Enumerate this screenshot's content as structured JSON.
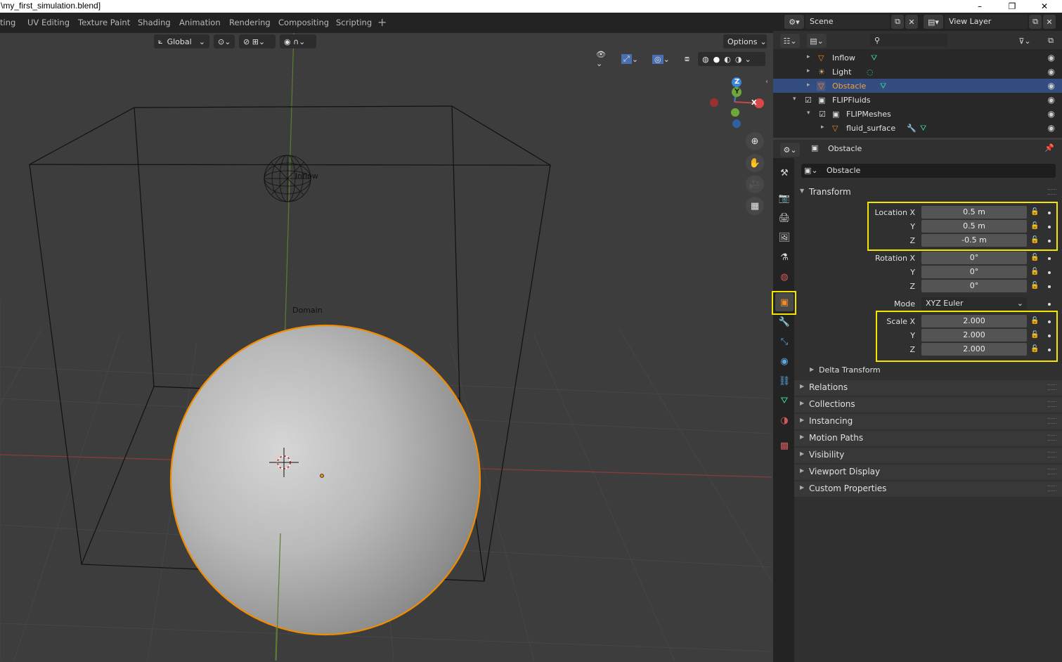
{
  "window": {
    "title": "\\my_first_simulation.blend]",
    "minimize": "–",
    "maximize": "❐",
    "close": "✕"
  },
  "workspaces": [
    "ting",
    "UV Editing",
    "Texture Paint",
    "Shading",
    "Animation",
    "Rendering",
    "Compositing",
    "Scripting"
  ],
  "add_workspace": "+",
  "scene": {
    "name": "Scene",
    "view_layer": "View Layer"
  },
  "viewport": {
    "orientation": "Global",
    "options_label": "Options",
    "labels": {
      "inflow": "Inflow",
      "domain": "Domain"
    },
    "gizmo": {
      "x": "X",
      "y": "Y",
      "z": "Z"
    }
  },
  "outliner": {
    "rows": [
      {
        "label": "Inflow",
        "icon": "mesh-icon",
        "data_icon": "vertex-icon"
      },
      {
        "label": "Light",
        "icon": "light-icon",
        "data_icon": "bulb-icon"
      },
      {
        "label": "Obstacle",
        "icon": "mesh-icon",
        "data_icon": "vertex-icon",
        "selected": true
      },
      {
        "label": "FLIPFluids",
        "icon": "collection-icon"
      },
      {
        "label": "FLIPMeshes",
        "icon": "collection-icon"
      },
      {
        "label": "fluid_surface",
        "icon": "mesh-icon",
        "data_icon": "wrench-icon"
      }
    ]
  },
  "properties": {
    "header_object": "Obstacle",
    "object_name": "Obstacle",
    "transform": {
      "title": "Transform",
      "location": {
        "label_x": "Location X",
        "label_y": "Y",
        "label_z": "Z",
        "x": "0.5 m",
        "y": "0.5 m",
        "z": "-0.5 m"
      },
      "rotation": {
        "label_x": "Rotation X",
        "label_y": "Y",
        "label_z": "Z",
        "x": "0°",
        "y": "0°",
        "z": "0°"
      },
      "mode_label": "Mode",
      "mode_value": "XYZ Euler",
      "scale": {
        "label_x": "Scale X",
        "label_y": "Y",
        "label_z": "Z",
        "x": "2.000",
        "y": "2.000",
        "z": "2.000"
      },
      "delta": "Delta Transform"
    },
    "panels": [
      "Relations",
      "Collections",
      "Instancing",
      "Motion Paths",
      "Visibility",
      "Viewport Display",
      "Custom Properties"
    ]
  },
  "colors": {
    "selection_outline": "#f08c00",
    "highlight_box": "#f5e300",
    "x_axis": "#a83c3c",
    "y_axis": "#6b9a3a",
    "selected_row": "#334d80"
  }
}
